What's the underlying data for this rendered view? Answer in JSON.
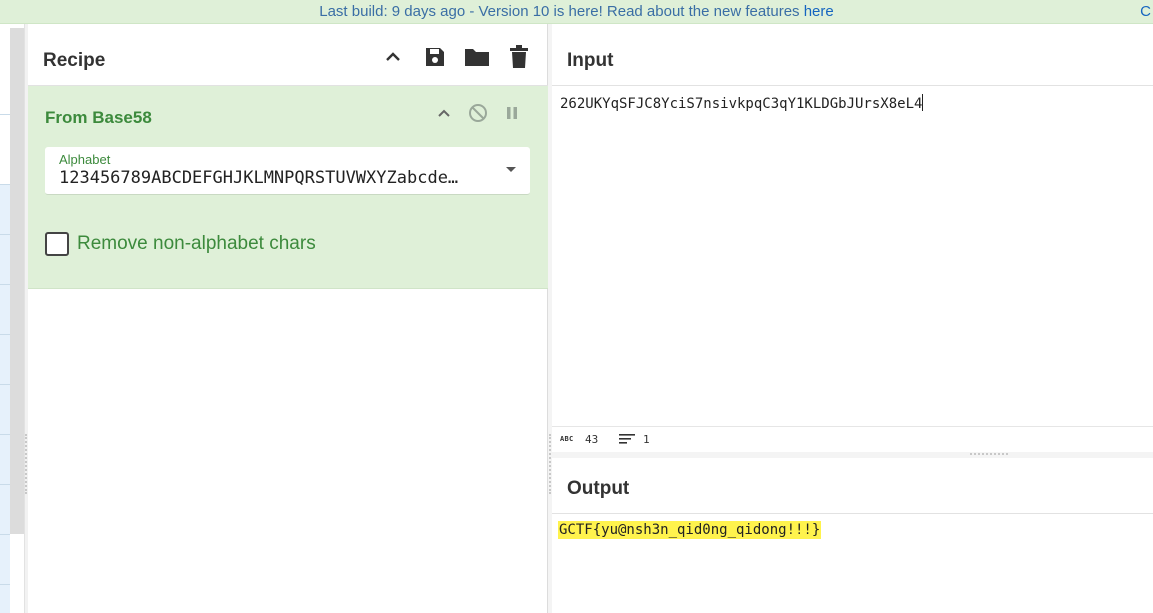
{
  "banner": {
    "text_pre": "Last build: 9 days ago - Version 10 is here! Read about the new features ",
    "link": "here",
    "tail": "C"
  },
  "recipe": {
    "title": "Recipe",
    "tools": [
      "chevron-up-icon",
      "save-icon",
      "folder-icon",
      "trash-icon"
    ],
    "operation": {
      "name": "From Base58",
      "alphabet_label": "Alphabet",
      "alphabet_value": "123456789ABCDEFGHJKLMNPQRSTUVWXYZabcde…",
      "remove_label": "Remove non-alphabet chars",
      "remove_checked": false
    }
  },
  "input": {
    "title": "Input",
    "text": "262UKYqSFJC8YciS7nsivkpqC3qY1KLDGbJUrsX8eL4"
  },
  "status": {
    "abc": "ABC",
    "length": "43",
    "lines": "1"
  },
  "output": {
    "title": "Output",
    "text": "GCTF{yu@nsh3n_qid0ng_qidong!!!}"
  },
  "colors": {
    "banner_bg": "#dff0d8",
    "op_bg": "#dff0d8",
    "op_text": "#3c8a3c",
    "highlight": "#fff34d"
  }
}
